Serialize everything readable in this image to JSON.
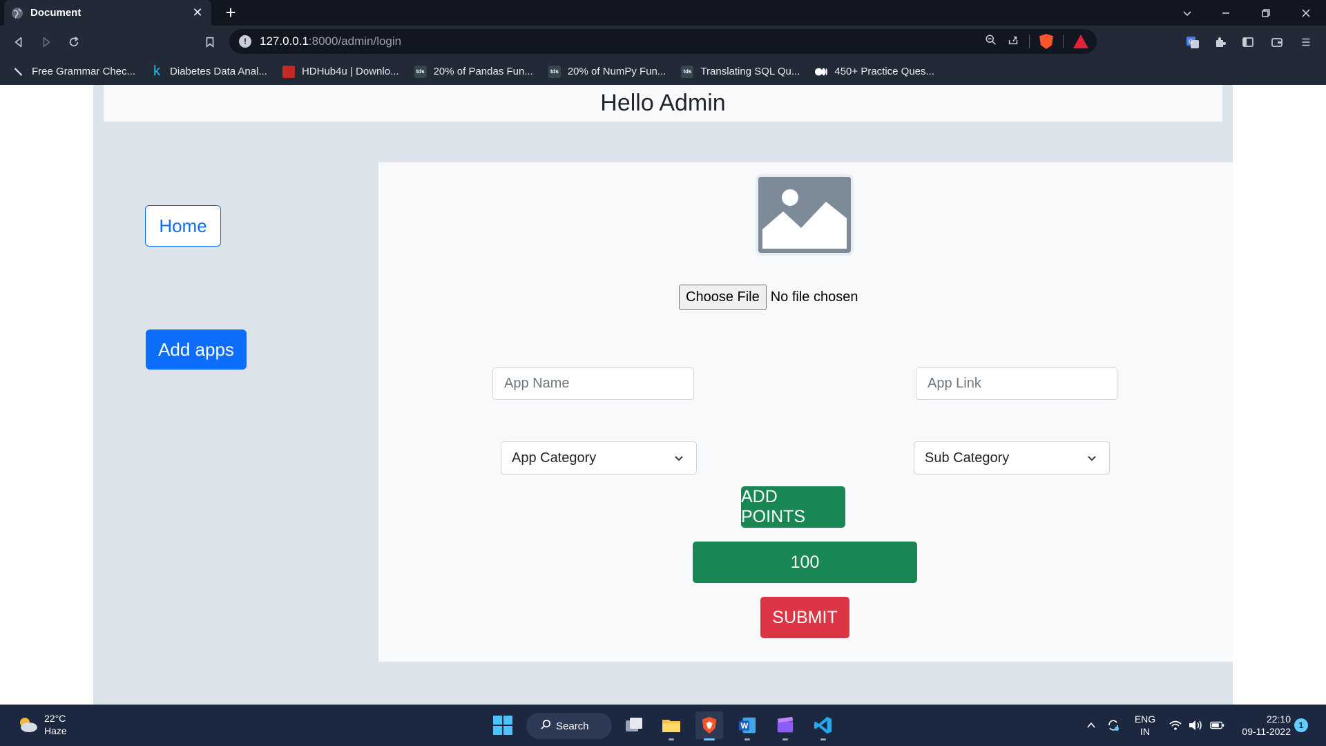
{
  "browser": {
    "tab_title": "Document",
    "url_host": "127.0.0.1",
    "url_rest": ":8000/admin/login",
    "bookmarks": [
      {
        "label": "Free Grammar Chec...",
        "icon": "pen-icon",
        "color": "#e8eaed"
      },
      {
        "label": "Diabetes Data Anal...",
        "icon": "kaggle-icon",
        "color": "#20beff"
      },
      {
        "label": "HDHub4u | Downlo...",
        "icon": "hdhub-icon",
        "color": "#c62828"
      },
      {
        "label": "20% of Pandas Fun...",
        "icon": "tds-icon",
        "color": "#37474f"
      },
      {
        "label": "20% of NumPy Fun...",
        "icon": "tds-icon",
        "color": "#37474f"
      },
      {
        "label": "Translating SQL Qu...",
        "icon": "tds-icon",
        "color": "#37474f"
      },
      {
        "label": "450+ Practice Ques...",
        "icon": "medium-icon",
        "color": "#ffffff"
      }
    ]
  },
  "page": {
    "heading": "Hello Admin",
    "nav": {
      "home_label": "Home",
      "add_apps_label": "Add apps"
    },
    "form": {
      "image_icon": "image-placeholder-icon",
      "file_button_label": "Choose File",
      "file_status": "No file chosen",
      "app_name_placeholder": "App Name",
      "app_link_placeholder": "App Link",
      "app_category_selected": "App Category",
      "sub_category_selected": "Sub Category",
      "add_points_label": "ADD POINTS",
      "points_value": "100",
      "submit_label": "SUBMIT"
    },
    "colors": {
      "primary": "#0d6efd",
      "success": "#198754",
      "danger": "#dc3545",
      "container_bg": "#dde3ea"
    }
  },
  "taskbar": {
    "temperature": "22°C",
    "weather_condition": "Haze",
    "search_label": "Search",
    "language_line1": "ENG",
    "language_line2": "IN",
    "time": "22:10",
    "date": "09-11-2022",
    "notification_count": "1"
  }
}
